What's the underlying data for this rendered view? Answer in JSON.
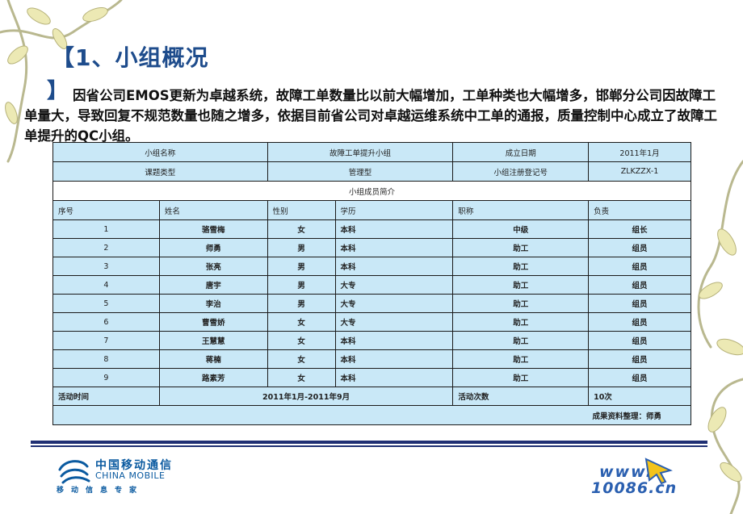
{
  "title": "【1、小组概况",
  "title_bracket_close": "】",
  "intro": "因省公司EMOS更新为卓越系统，故障工单数量比以前大幅增加，工单种类也大幅增多，邯郸分公司因故障工单量大，导致回复不规范数量也随之增多，依据目前省公司对卓越运维系统中工单的通报，质量控制中心成立了故障工单提升的QC小组。",
  "info": {
    "group_name_label": "小组名称",
    "group_name": "故障工单提升小组",
    "founded_label": "成立日期",
    "founded": "2011年1月",
    "topic_type_label": "课题类型",
    "topic_type": "管理型",
    "reg_no_label": "小组注册登记号",
    "reg_no": "ZLKZZX-1",
    "members_title": "小组成员简介"
  },
  "columns": [
    "序号",
    "姓名",
    "性别",
    "学历",
    "职称",
    "负责"
  ],
  "members": [
    {
      "no": "1",
      "name": "骆雪梅",
      "gender": "女",
      "edu": "本科",
      "title": "中级",
      "role": "组长"
    },
    {
      "no": "2",
      "name": "师勇",
      "gender": "男",
      "edu": "本科",
      "title": "助工",
      "role": "组员"
    },
    {
      "no": "3",
      "name": "张亮",
      "gender": "男",
      "edu": "本科",
      "title": "助工",
      "role": "组员"
    },
    {
      "no": "4",
      "name": "唐宇",
      "gender": "男",
      "edu": "大专",
      "title": "助工",
      "role": "组员"
    },
    {
      "no": "5",
      "name": "李治",
      "gender": "男",
      "edu": "大专",
      "title": "助工",
      "role": "组员"
    },
    {
      "no": "6",
      "name": "曹雪娇",
      "gender": "女",
      "edu": "大专",
      "title": "助工",
      "role": "组员"
    },
    {
      "no": "7",
      "name": "王慧慧",
      "gender": "女",
      "edu": "本科",
      "title": "助工",
      "role": "组员"
    },
    {
      "no": "8",
      "name": "蒋楠",
      "gender": "女",
      "edu": "本科",
      "title": "助工",
      "role": "组员"
    },
    {
      "no": "9",
      "name": "路素芳",
      "gender": "女",
      "edu": "本科",
      "title": "助工",
      "role": "组员"
    }
  ],
  "activity": {
    "time_label": "活动时间",
    "time": "2011年1月-2011年9月",
    "count_label": "活动次数",
    "count": "10次"
  },
  "note": "成果资料整理：师勇",
  "footer": {
    "logo_cn": "中国移动通信",
    "logo_en": "CHINA MOBILE",
    "slogan": "移动信息专家",
    "web_www": "www.",
    "web_domain": "10086.cn"
  },
  "colors": {
    "title": "#1e4c8c",
    "table_bg": "#c9e8f7",
    "rule": "#1f2f73",
    "brand": "#0a5aa0"
  }
}
